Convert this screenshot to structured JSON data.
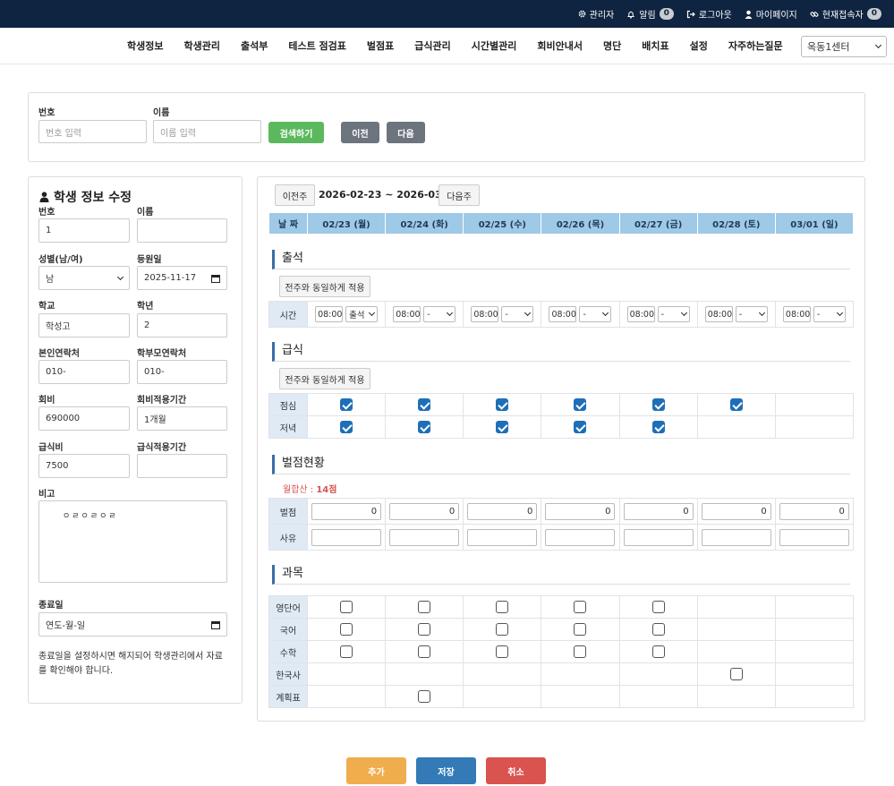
{
  "topbar": {
    "admin": "관리자",
    "alerts": "알림",
    "alerts_count": "0",
    "logout": "로그아웃",
    "mypage": "마이페이지",
    "online": "현재접속자",
    "online_count": "0"
  },
  "nav": {
    "items": [
      "학생정보",
      "학생관리",
      "출석부",
      "테스트 점검표",
      "벌점표",
      "급식관리",
      "시간별관리",
      "회비안내서",
      "명단",
      "배치표",
      "설정",
      "자주하는질문"
    ],
    "center": "옥동1센터"
  },
  "search": {
    "number_label": "번호",
    "number_placeholder": "번호 입력",
    "name_label": "이름",
    "name_placeholder": "이름 입력",
    "search_button": "검색하기",
    "prev_button": "이전",
    "next_button": "다음"
  },
  "student": {
    "title": "학생 정보 수정",
    "fields": {
      "number_label": "번호",
      "number": "1",
      "name_label": "이름",
      "name": "",
      "gender_label": "성별(남/여)",
      "gender": "남",
      "regdate_label": "등원일",
      "regdate": "2025-11-17",
      "school_label": "학교",
      "school": "학성고",
      "grade_label": "학년",
      "grade": "2",
      "phone_label": "본인연락처",
      "phone": "010-",
      "parent_label": "학부모연락처",
      "parent": "010-",
      "fee_label": "회비",
      "fee": "690000",
      "fee_period_label": "회비적용기간",
      "fee_period": "1개월",
      "meal_label": "급식비",
      "meal": "7500",
      "meal_period_label": "급식적용기간",
      "meal_period": "",
      "memo_label": "비고",
      "memo": "ㅇㄹㅇㄹㅇㄹ",
      "end_label": "종료일",
      "end_placeholder": "연도-월-일"
    },
    "note": "종료일을 설정하시면 해지되어 학생관리에서 자료를 확인해야 합니다."
  },
  "week": {
    "prev": "이전주",
    "range": "2026-02-23 ~ 2026-03-01",
    "next": "다음주",
    "corner": "날 짜",
    "days": [
      "02/23 (월)",
      "02/24 (화)",
      "02/25 (수)",
      "02/26 (목)",
      "02/27 (금)",
      "02/28 (토)",
      "03/01 (일)"
    ]
  },
  "attendance": {
    "title": "출석",
    "copy_button": "전주와 동일하게 적용",
    "row_label": "시간",
    "times": [
      "08:00",
      "08:00",
      "08:00",
      "08:00",
      "08:00",
      "08:00",
      "08:00"
    ],
    "statuses": [
      "출석",
      "-",
      "-",
      "-",
      "-",
      "-",
      "-"
    ]
  },
  "meals": {
    "title": "급식",
    "copy_button": "전주와 동일하게 적용",
    "lunch_label": "점심",
    "dinner_label": "저녁",
    "lunch": [
      true,
      true,
      true,
      true,
      true,
      true,
      null
    ],
    "dinner": [
      true,
      true,
      true,
      true,
      true,
      null,
      null
    ]
  },
  "penalty": {
    "title": "벌점현황",
    "monthly_label": "월합산 :",
    "monthly_value": "14점",
    "score_label": "벌점",
    "reason_label": "사유",
    "scores": [
      "0",
      "0",
      "0",
      "0",
      "0",
      "0",
      "0"
    ]
  },
  "subjects": {
    "title": "과목",
    "rows": [
      {
        "label": "영단어",
        "cells": [
          false,
          false,
          false,
          false,
          false,
          null,
          null
        ]
      },
      {
        "label": "국어",
        "cells": [
          false,
          false,
          false,
          false,
          false,
          null,
          null
        ]
      },
      {
        "label": "수학",
        "cells": [
          false,
          false,
          false,
          false,
          false,
          null,
          null
        ]
      },
      {
        "label": "한국사",
        "cells": [
          null,
          null,
          null,
          null,
          null,
          false,
          null
        ]
      },
      {
        "label": "계획표",
        "cells": [
          null,
          false,
          null,
          null,
          null,
          null,
          null
        ]
      }
    ]
  },
  "footer": {
    "add": "추가",
    "save": "저장",
    "cancel": "취소"
  },
  "colors": {
    "topbar": "#0e2440",
    "green": "#5cb85c",
    "gray": "#6c757d",
    "blue": "#337ab7",
    "orange": "#f0ad4e",
    "red": "#d9534f",
    "header": "#9ec9e7"
  }
}
